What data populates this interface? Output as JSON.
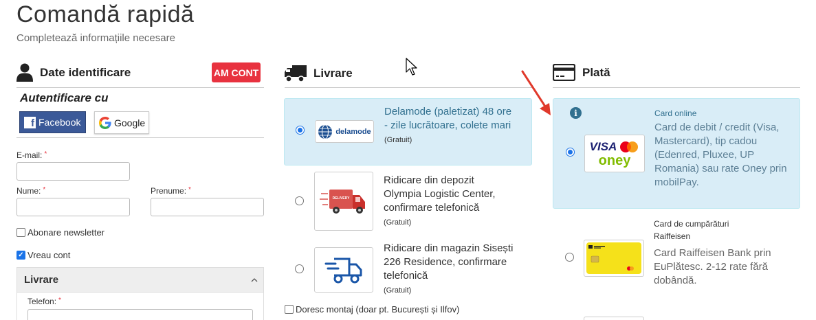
{
  "header": {
    "title": "Comandă rapidă",
    "subtitle": "Completează informațiile necesare"
  },
  "identification": {
    "heading": "Date identificare",
    "account_button": "AM CONT",
    "auth_title": "Autentificare cu",
    "facebook_label": "Facebook",
    "google_label": "Google",
    "email_label": "E-mail:",
    "nume_label": "Nume:",
    "prenume_label": "Prenume:",
    "required_mark": "*",
    "newsletter_label": "Abonare newsletter",
    "account_label": "Vreau cont",
    "panel_title": "Livrare",
    "phone_label": "Telefon:"
  },
  "delivery": {
    "heading": "Livrare",
    "options": [
      {
        "logo": "delamode",
        "text": "Delamode (paletizat) 48 ore - zile lucrătoare, colete mari",
        "price": "(Gratuit)",
        "selected": true
      },
      {
        "logo": "DELIVERY",
        "text": "Ridicare din depozit Olympia Logistic Center, confirmare telefonică",
        "price": "(Gratuit)",
        "selected": false
      },
      {
        "logo": "truck-icon",
        "text": "Ridicare din magazin Sisești 226 Residence, confirmare telefonică",
        "price": "(Gratuit)",
        "selected": false
      }
    ],
    "montaj_label": "Doresc montaj (doar pt. București și Ilfov)"
  },
  "payment": {
    "heading": "Plată",
    "options": [
      {
        "title": "Card online",
        "description": "Card de debit / credit (Visa, Mastercard), tip cadou (Edenred, Pluxee, UP Romania) sau rate Oney prin mobilPay.",
        "logo_top": "VISA",
        "logo_bottom": "oney",
        "selected": true
      },
      {
        "title": "Card de cumpărături Raiffeisen",
        "description": "Card Raiffeisen Bank prin EuPlătesc. 2-12 rate fără dobândă.",
        "selected": false
      }
    ]
  },
  "colors": {
    "accent_red": "#e8323f",
    "selected_bg": "#d9edf7",
    "selected_text": "#31708f",
    "facebook_blue": "#3b5998"
  }
}
